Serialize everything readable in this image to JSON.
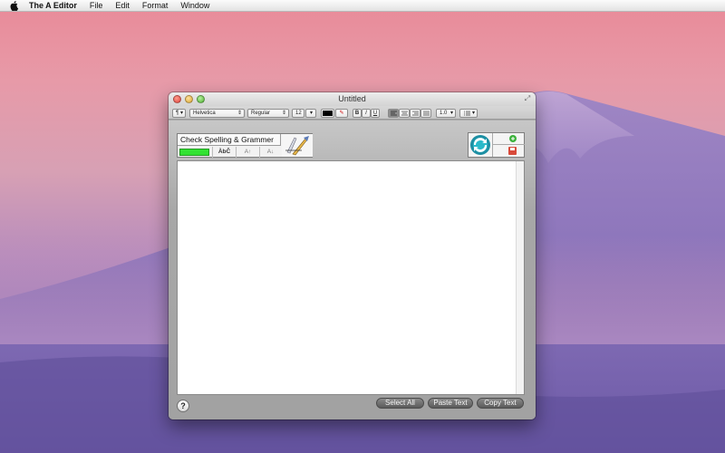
{
  "menubar": {
    "app_name": "The A Editor",
    "items": [
      "File",
      "Edit",
      "Format",
      "Window"
    ]
  },
  "window": {
    "title": "Untitled"
  },
  "format_bar": {
    "paragraph_label": "¶",
    "font_family": "Helvetica",
    "font_style": "Regular",
    "font_size": "12",
    "bold_label": "B",
    "italic_label": "I",
    "underline_label": "U",
    "line_spacing": "1.0",
    "text_color": "#000000"
  },
  "spelling_panel": {
    "check_button_label": "Check Spelling & Grammer",
    "progress": 1.0,
    "abc_label": "ÀbČ",
    "font_up_label": "A↑",
    "font_down_label": "A↓"
  },
  "bottom_bar": {
    "help_label": "?",
    "select_all_label": "Select All",
    "paste_text_label": "Paste Text",
    "copy_text_label": "Copy Text"
  },
  "colors": {
    "progress_green": "#33e233",
    "desktop_top": "#e98a98",
    "desktop_bottom": "#6d5aa4"
  }
}
